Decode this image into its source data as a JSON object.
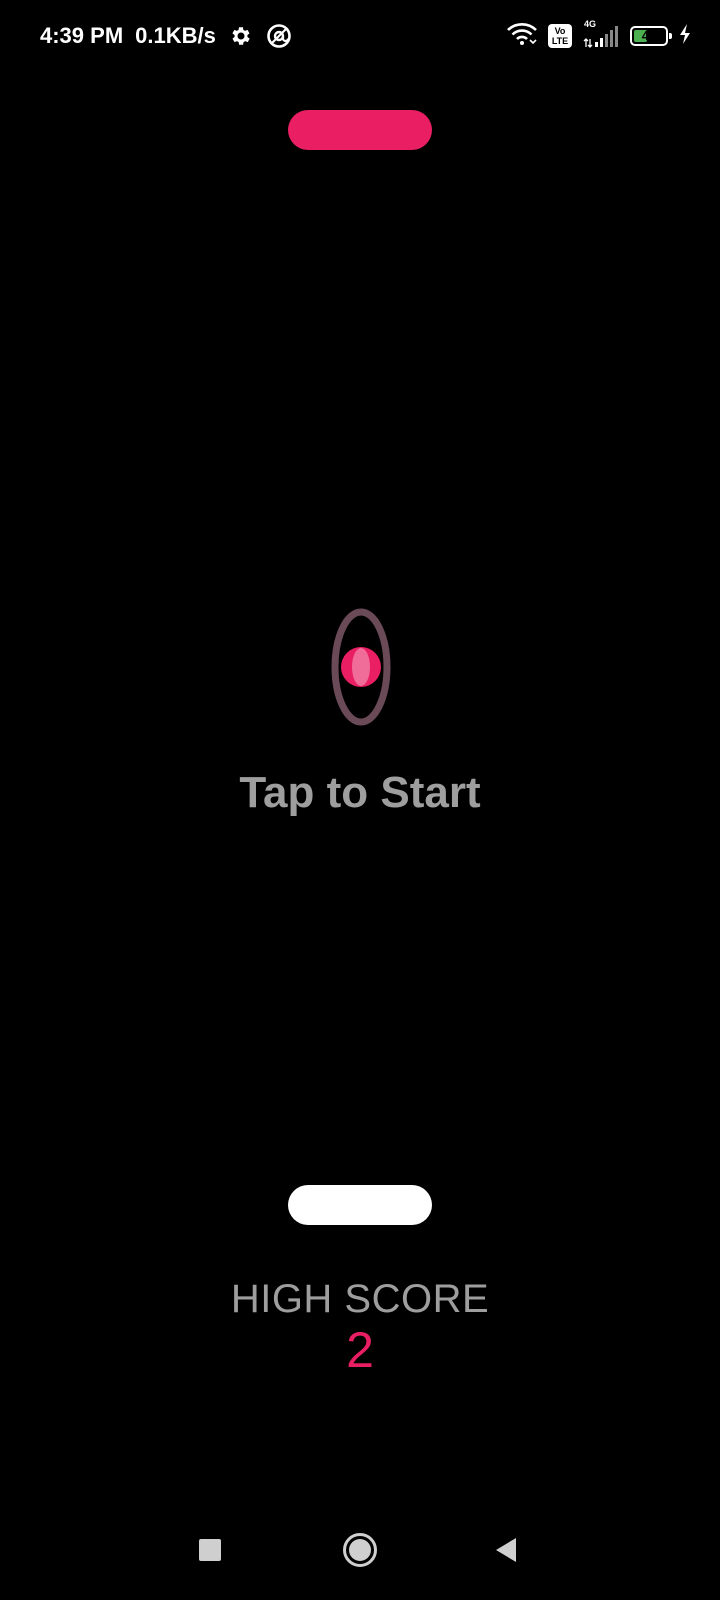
{
  "status_bar": {
    "time": "4:39 PM",
    "net_speed": "0.1KB/s",
    "icons_left": [
      "gear-icon",
      "vpn-at-icon"
    ],
    "icons_right": [
      "wifi-icon",
      "volte-icon",
      "cell-signal-icon",
      "battery-icon",
      "charging-icon"
    ],
    "volte_top": "Vo",
    "volte_bottom": "LTE",
    "network_type": "4G",
    "battery_level": "42",
    "battery_fraction": 0.42
  },
  "game": {
    "start_prompt": "Tap to Start",
    "high_score_label": "HIGH SCORE",
    "high_score_value": "2"
  },
  "colors": {
    "accent": "#E91E63",
    "paddle_bottom": "#FFFFFF",
    "ring": "#6B4A58",
    "text_muted": "#9E9E9E",
    "background": "#000000"
  },
  "nav_bar": {
    "icons": [
      "recent-apps-icon",
      "home-icon",
      "back-icon"
    ]
  }
}
